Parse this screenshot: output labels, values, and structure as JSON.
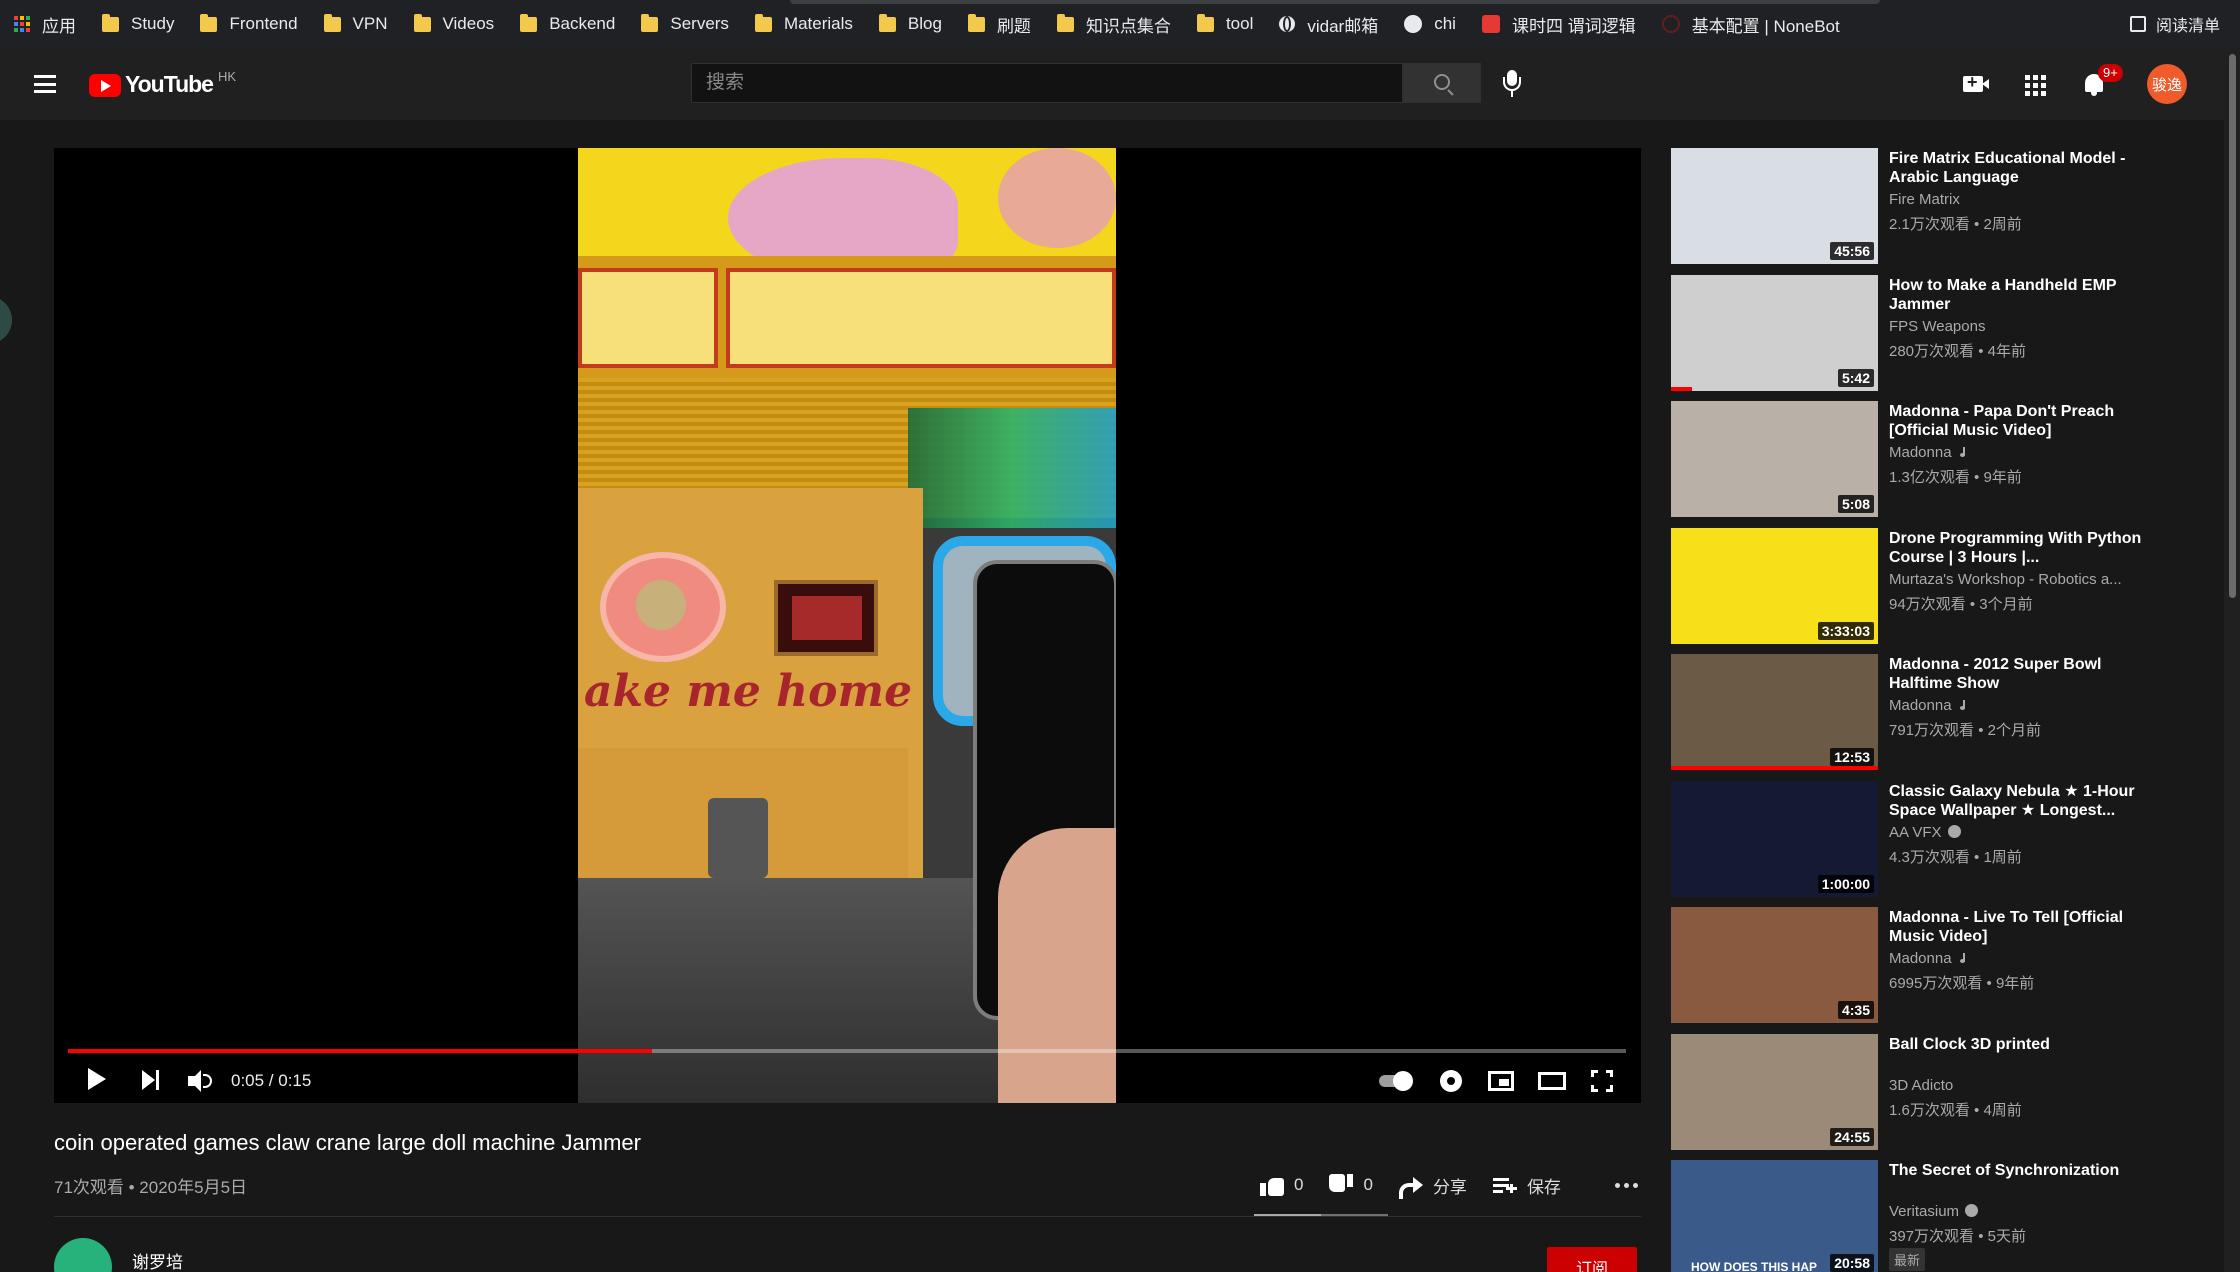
{
  "bookmarks": [
    {
      "label": "应用",
      "icon": "apps-icon"
    },
    {
      "label": "Study",
      "icon": "folder-icon"
    },
    {
      "label": "Frontend",
      "icon": "folder-icon"
    },
    {
      "label": "VPN",
      "icon": "folder-icon"
    },
    {
      "label": "Videos",
      "icon": "folder-icon"
    },
    {
      "label": "Backend",
      "icon": "folder-icon"
    },
    {
      "label": "Servers",
      "icon": "folder-icon"
    },
    {
      "label": "Materials",
      "icon": "folder-icon"
    },
    {
      "label": "Blog",
      "icon": "folder-icon"
    },
    {
      "label": "刷题",
      "icon": "folder-icon"
    },
    {
      "label": "知识点集合",
      "icon": "folder-icon"
    },
    {
      "label": "tool",
      "icon": "folder-icon"
    },
    {
      "label": "vidar邮箱",
      "icon": "globe-icon"
    },
    {
      "label": "chi",
      "icon": "github-icon"
    },
    {
      "label": "课时四 谓词逻辑",
      "icon": "red-site-icon"
    },
    {
      "label": "基本配置 | NoneBot",
      "icon": "nonebot-icon"
    }
  ],
  "reading_list": "阅读清单",
  "masthead": {
    "logo_text": "YouTube",
    "region": "HK",
    "search_placeholder": "搜索",
    "notification_count": "9+",
    "avatar_text": "骏逸",
    "colors": {
      "logo_red": "#ff0000",
      "avatar": "#ef5b2b"
    }
  },
  "player": {
    "time": "0:05 / 0:15",
    "progress": 0.375,
    "video_text": "ake me home"
  },
  "video": {
    "title": "coin operated games claw crane large doll machine Jammer",
    "meta": "71次观看 • 2020年5月5日",
    "likes": "0",
    "dislikes": "0",
    "share_label": "分享",
    "save_label": "保存",
    "like_ratio": 0.5
  },
  "channel": {
    "name": "谢罗培",
    "subscribe_label": "订阅"
  },
  "recommendations": [
    {
      "title": "Fire Matrix Educational Model - Arabic Language",
      "channel": "Fire Matrix",
      "meta": "2.1万次观看 • 2周前",
      "duration": "45:56",
      "thumb_bg": "#d9dde4",
      "music": false,
      "verified": false
    },
    {
      "title": "How to Make a Handheld EMP Jammer",
      "channel": "FPS Weapons",
      "meta": "280万次观看 • 4年前",
      "duration": "5:42",
      "thumb_bg": "#cfcfcf",
      "music": false,
      "verified": false,
      "watched": 0.1
    },
    {
      "title": "Madonna - Papa Don't Preach [Official Music Video]",
      "channel": "Madonna",
      "meta": "1.3亿次观看 • 9年前",
      "duration": "5:08",
      "thumb_bg": "#b9b0a8",
      "music": true,
      "verified": false
    },
    {
      "title": "Drone Programming With Python Course | 3 Hours |...",
      "channel": "Murtaza's Workshop - Robotics a...",
      "meta": "94万次观看 • 3个月前",
      "duration": "3:33:03",
      "thumb_bg": "#f7e017",
      "music": false,
      "verified": false
    },
    {
      "title": "Madonna - 2012 Super Bowl Halftime Show",
      "channel": "Madonna",
      "meta": "791万次观看 • 2个月前",
      "duration": "12:53",
      "thumb_bg": "#6a5a46",
      "music": true,
      "verified": false,
      "watched": 1.0
    },
    {
      "title": "Classic Galaxy Nebula ★ 1-Hour Space Wallpaper ★ Longest...",
      "channel": "AA VFX",
      "meta": "4.3万次观看 • 1周前",
      "duration": "1:00:00",
      "thumb_bg": "#141a33",
      "music": false,
      "verified": true
    },
    {
      "title": "Madonna - Live To Tell [Official Music Video]",
      "channel": "Madonna",
      "meta": "6995万次观看 • 9年前",
      "duration": "4:35",
      "thumb_bg": "#8a5a40",
      "music": true,
      "verified": false
    },
    {
      "title": "Ball Clock 3D printed",
      "channel": "3D Adicto",
      "meta": "1.6万次观看 • 4周前",
      "duration": "24:55",
      "thumb_bg": "#9c8a78",
      "music": false,
      "verified": false
    },
    {
      "title": "The Secret of Synchronization",
      "channel": "Veritasium",
      "meta": "397万次观看 • 5天前",
      "duration": "20:58",
      "thumb_bg": "#3a5a8a",
      "music": false,
      "verified": true,
      "badge": "最新",
      "thumb_caption": "HOW DOES THIS HAP"
    }
  ]
}
